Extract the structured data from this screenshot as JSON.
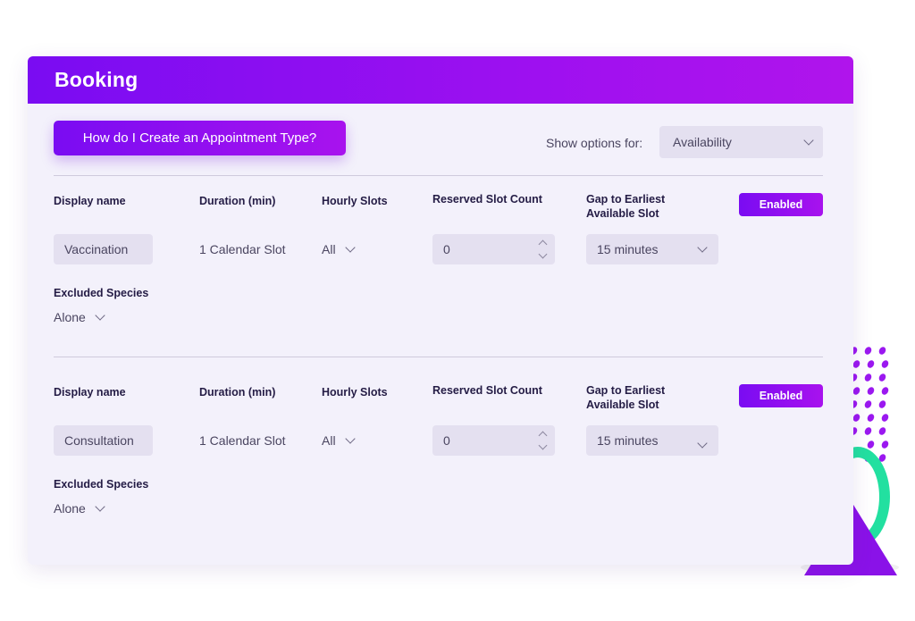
{
  "header": {
    "title": "Booking"
  },
  "toolbar": {
    "help_button": "How do I Create an Appointment Type?",
    "show_options_label": "Show options for:",
    "show_options_value": "Availability"
  },
  "columns": {
    "display_name": "Display name",
    "duration": "Duration (min)",
    "hourly_slots": "Hourly Slots",
    "reserved_slot_count": "Reserved Slot Count",
    "gap_line1": "Gap to Earliest",
    "gap_line2": "Available Slot",
    "excluded_species": "Excluded Species"
  },
  "appointment_types": [
    {
      "display_name": "Vaccination",
      "duration": "1 Calendar Slot",
      "hourly_slots": "All",
      "reserved_slot_count": "0",
      "gap": "15 minutes",
      "status": "Enabled",
      "excluded_species": "Alone"
    },
    {
      "display_name": "Consultation",
      "duration": "1 Calendar Slot",
      "hourly_slots": "All",
      "reserved_slot_count": "0",
      "gap": "15 minutes",
      "status": "Enabled",
      "excluded_species": "Alone"
    }
  ],
  "colors": {
    "brand_purple": "#7a0cf2",
    "brand_magenta": "#b014ec",
    "card_bg": "#f3f1fb",
    "field_bg": "#e4e0f0",
    "accent_green": "#22e0a0"
  }
}
